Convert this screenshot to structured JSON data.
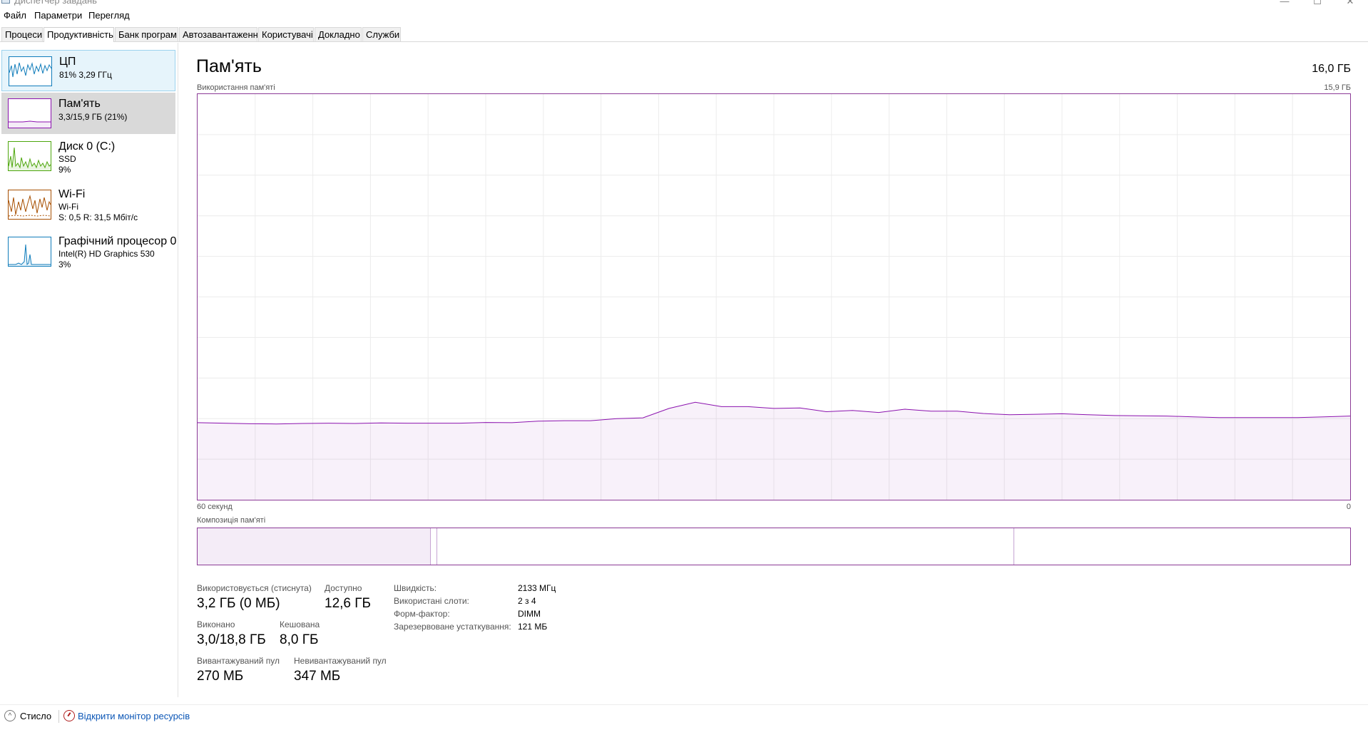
{
  "window": {
    "title": "Диспетчер завдань",
    "minimize": "—",
    "maximize": "☐",
    "close": "✕"
  },
  "menu": [
    "Файл",
    "Параметри",
    "Перегляд"
  ],
  "tabs": [
    "Процеси",
    "Продуктивність",
    "Банк програм",
    "Автозавантаження",
    "Користувачі",
    "Докладно",
    "Служби"
  ],
  "active_tab": "Продуктивність",
  "sidebar": {
    "items": [
      {
        "title": "ЦП",
        "line1": "81% 3,29 ГГц",
        "line2": "",
        "color": "#117dbb"
      },
      {
        "title": "Пам'ять",
        "line1": "3,3/15,9 ГБ (21%)",
        "line2": "",
        "color": "#8b12ae"
      },
      {
        "title": "Диск 0 (C:)",
        "line1": "SSD",
        "line2": "9%",
        "color": "#4da60c"
      },
      {
        "title": "Wi-Fi",
        "line1": "Wi-Fi",
        "line2": "S: 0,5  R: 31,5 Мбіт/с",
        "color": "#a74f01"
      },
      {
        "title": "Графічний процесор 0",
        "line1": "Intel(R) HD Graphics 530",
        "line2": "3%",
        "color": "#117dbb"
      }
    ]
  },
  "main": {
    "title": "Пам'ять",
    "total": "16,0 ГБ",
    "usage_label": "Використання пам'яті",
    "usage_max": "15,9 ГБ",
    "time_left": "60 секунд",
    "time_right": "0",
    "composition_label": "Композиція пам'яті",
    "accent": "#8b12ae"
  },
  "stats": {
    "in_use_label": "Використовується (стиснута)",
    "in_use_value": "3,2 ГБ (0 МБ)",
    "available_label": "Доступно",
    "available_value": "12,6 ГБ",
    "committed_label": "Виконано",
    "committed_value": "3,0/18,8 ГБ",
    "cached_label": "Кешована",
    "cached_value": "8,0 ГБ",
    "paged_label": "Вивантажуваний пул",
    "paged_value": "270 МБ",
    "nonpaged_label": "Невивантажуваний пул",
    "nonpaged_value": "347 МБ"
  },
  "properties": [
    {
      "label": "Швидкість:",
      "value": "2133 МГц"
    },
    {
      "label": "Використані слоти:",
      "value": "2 з 4"
    },
    {
      "label": "Форм-фактор:",
      "value": "DIMM"
    },
    {
      "label": "Зарезервоване устаткування:",
      "value": "121 МБ"
    }
  ],
  "footer": {
    "less": "Стисло",
    "resmon": "Відкрити монітор ресурсів"
  },
  "chart_data": {
    "type": "area",
    "ylim": [
      0,
      15.9
    ],
    "x_range_seconds": [
      60,
      0
    ],
    "series": [
      {
        "values": [
          3.02,
          3.0,
          2.98,
          2.97,
          2.99,
          3.0,
          2.99,
          3.01,
          3.0,
          3.0,
          3.0,
          3.03,
          3.02,
          3.08,
          3.1,
          3.1,
          3.18,
          3.21,
          3.58,
          3.82,
          3.65,
          3.65,
          3.58,
          3.6,
          3.45,
          3.5,
          3.42,
          3.55,
          3.47,
          3.47,
          3.38,
          3.33,
          3.35,
          3.37,
          3.33,
          3.3,
          3.29,
          3.28,
          3.25,
          3.22,
          3.22,
          3.22,
          3.22,
          3.25,
          3.28
        ]
      }
    ],
    "grid": true
  },
  "composition": {
    "in_use_fraction": 0.202,
    "modified_fraction": 0.005,
    "standby_fraction": 0.5
  }
}
